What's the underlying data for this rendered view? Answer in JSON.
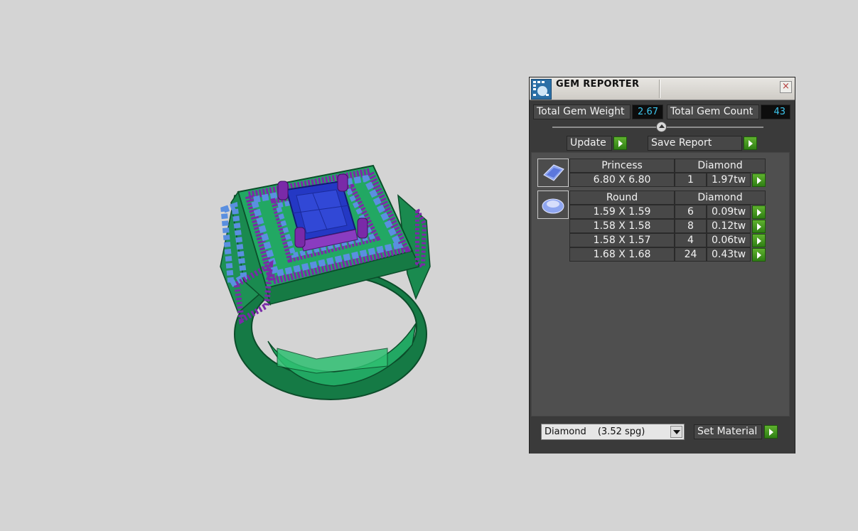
{
  "panel": {
    "title": "GEM REPORTER",
    "close_label": "×",
    "total_weight_label": "Total Gem Weight",
    "total_weight_value": "2.67",
    "total_count_label": "Total Gem Count",
    "total_count_value": "43",
    "update_label": "Update",
    "save_report_label": "Save Report",
    "groups": [
      {
        "shape": "Princess",
        "material": "Diamond",
        "icon": "princess-gem-icon",
        "rows": [
          {
            "size": "6.80 X 6.80",
            "count": "1",
            "weight": "1.97tw"
          }
        ]
      },
      {
        "shape": "Round",
        "material": "Diamond",
        "icon": "round-gem-icon",
        "rows": [
          {
            "size": "1.59 X 1.59",
            "count": "6",
            "weight": "0.09tw"
          },
          {
            "size": "1.58 X 1.58",
            "count": "8",
            "weight": "0.12tw"
          },
          {
            "size": "1.58 X 1.57",
            "count": "4",
            "weight": "0.06tw"
          },
          {
            "size": "1.68 X 1.68",
            "count": "24",
            "weight": "0.43tw"
          }
        ]
      }
    ],
    "material_select": {
      "name": "Diamond",
      "spg": "(3.52 spg)"
    },
    "set_material_label": "Set Material"
  },
  "colors": {
    "background": "#d4d4d4",
    "ring_metal": "#1f9a5a",
    "center_stone": "#2438c4",
    "accent_stones": "#5a8fe0",
    "prongs": "#7a2aa8",
    "value_text": "#3cc6ee",
    "go_button": "#3f9a1f"
  }
}
